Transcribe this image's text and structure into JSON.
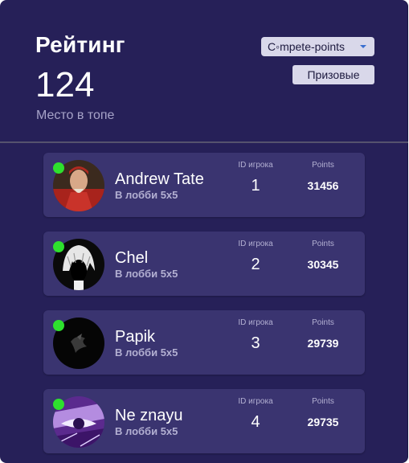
{
  "header": {
    "title": "Рейтинг",
    "rank": "124",
    "rank_caption": "Место в топе",
    "mode_select_value": "C◦mpete-points",
    "prize_button_label": "Призовые"
  },
  "columns": {
    "id_label": "ID игрока",
    "points_label": "Points"
  },
  "colors": {
    "background": "#262058",
    "card": "#3a3470",
    "online": "#2ee02e",
    "accent_chevron": "#3a6fd0"
  },
  "players": [
    {
      "name": "Andrew Tate",
      "status": "В лобби 5x5",
      "id": "1",
      "points": "31456",
      "avatar": "portrait-red-robe-avatar"
    },
    {
      "name": "Chel",
      "status": "В лобби 5x5",
      "id": "2",
      "points": "30345",
      "avatar": "dark-hair-sketch-avatar"
    },
    {
      "name": "Papik",
      "status": "В лобби 5x5",
      "id": "3",
      "points": "29739",
      "avatar": "black-emblem-avatar"
    },
    {
      "name": "Ne znayu",
      "status": "В лобби 5x5",
      "id": "4",
      "points": "29735",
      "avatar": "purple-anime-avatar"
    }
  ]
}
